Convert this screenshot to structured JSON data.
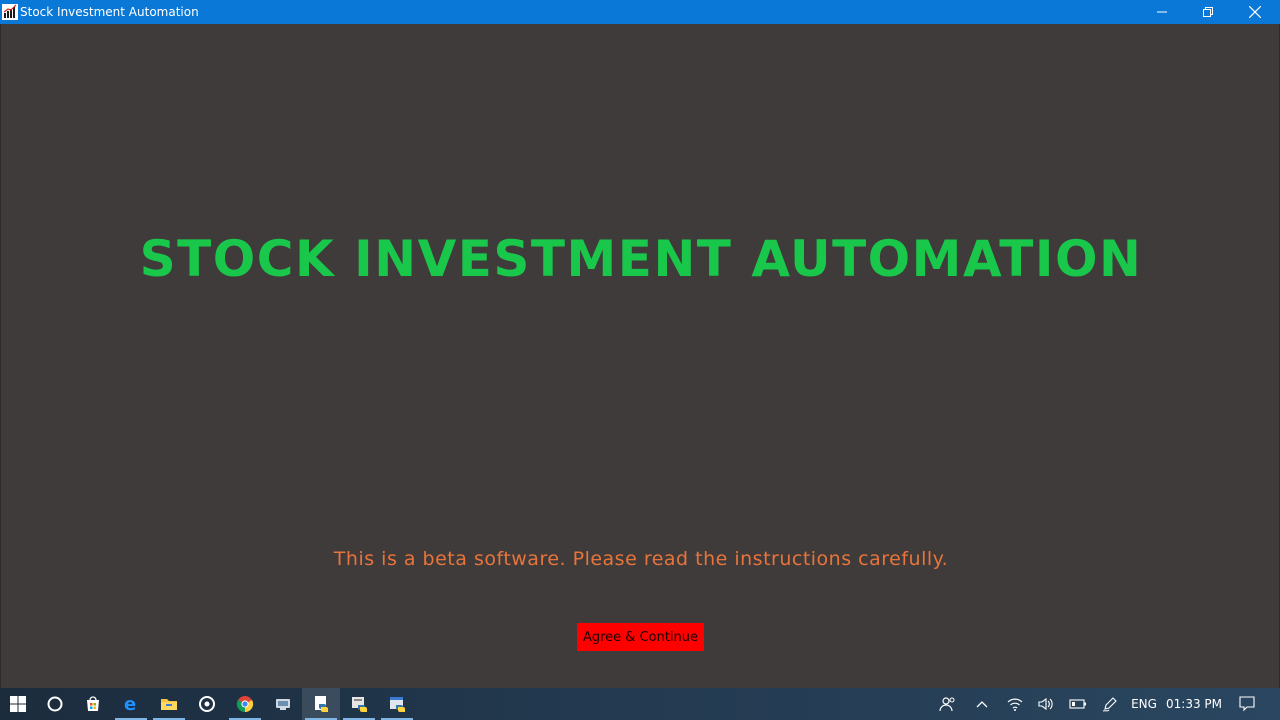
{
  "window": {
    "title": "Stock Investment Automation",
    "controls": [
      "minimize-icon",
      "restore-icon",
      "close-icon"
    ]
  },
  "main": {
    "headline": "STOCK INVESTMENT AUTOMATION",
    "notice": "This is a beta software. Please read the instructions carefully.",
    "agree_button": "Agree & Continue"
  },
  "colors": {
    "titlebar": "#0a78d7",
    "background": "#3f3b3b",
    "headline": "#19c84a",
    "notice": "#e8743b",
    "button": "#ff0000"
  },
  "taskbar": {
    "apps": [
      "start-icon",
      "cortana-icon",
      "store-icon",
      "edge-icon",
      "file-explorer-icon",
      "groove-icon",
      "chrome-icon",
      "app-icon",
      "python-app-icon",
      "python-app-icon",
      "python-app-icon"
    ],
    "language": "ENG",
    "time": "01:33 PM"
  }
}
